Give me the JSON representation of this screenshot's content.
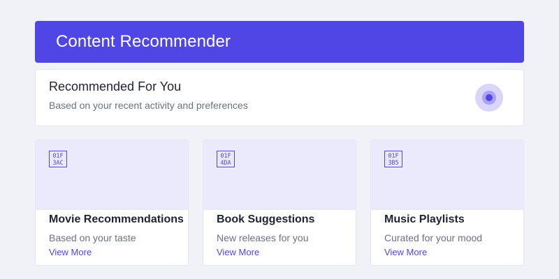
{
  "header": {
    "title": "Content Recommender"
  },
  "recommended": {
    "title": "Recommended For You",
    "subtitle": "Based on your recent activity and preferences",
    "indicator_icon": "radio-indicator-icon"
  },
  "cards": [
    {
      "icon": "film-clapper-icon",
      "icon_codepoint": "1F3AC",
      "title": "Movie Recommendations",
      "description": "Based on your taste",
      "link": "View More"
    },
    {
      "icon": "books-icon",
      "icon_codepoint": "1F4DA",
      "title": "Book Suggestions",
      "description": "New releases for you",
      "link": "View More"
    },
    {
      "icon": "music-note-icon",
      "icon_codepoint": "1F3B5",
      "title": "Music Playlists",
      "description": "Curated for your mood",
      "link": "View More"
    }
  ],
  "colors": {
    "accent": "#4f46e5",
    "page_background": "#f0f2f7",
    "thumb_background": "#ebeafc",
    "text_primary": "#1f2233",
    "text_secondary": "#6b7180"
  }
}
